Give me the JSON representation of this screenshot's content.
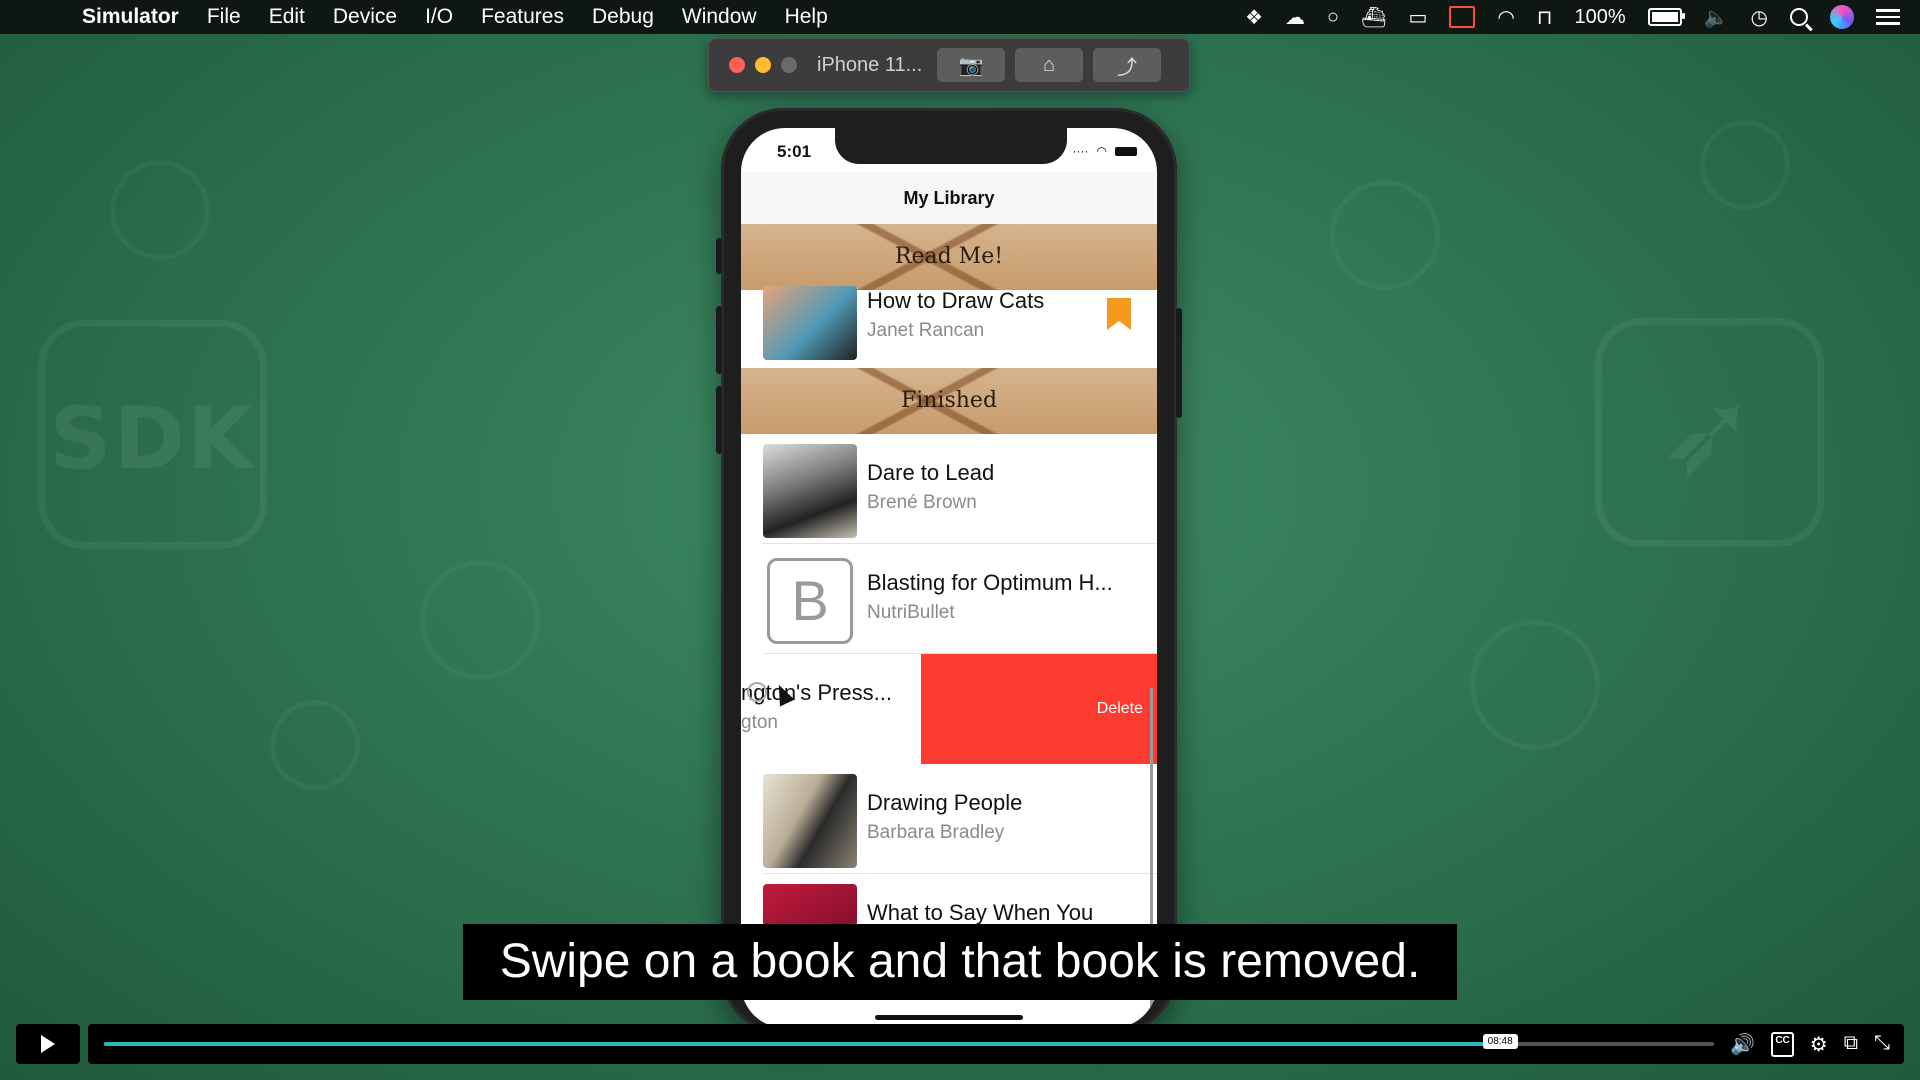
{
  "menubar": {
    "app_name": "Simulator",
    "items": [
      "File",
      "Edit",
      "Device",
      "I/O",
      "Features",
      "Debug",
      "Window",
      "Help"
    ],
    "battery_percent": "100%"
  },
  "simulator": {
    "device_name": "iPhone 11...",
    "buttons": [
      "camera-icon",
      "home-icon",
      "rotate-icon"
    ]
  },
  "phone": {
    "status_time": "5:01",
    "nav_title": "My Library",
    "sections": [
      {
        "title": "Read Me!"
      },
      {
        "title": "Finished"
      }
    ],
    "read_me_books": [
      {
        "title": "How to Draw Cats",
        "author": "Janet Rancan",
        "bookmarked": true
      }
    ],
    "finished_books": [
      {
        "title": "Dare to Lead",
        "author": "Brené Brown"
      },
      {
        "title": "Blasting for Optimum H...",
        "author": "NutriBullet",
        "placeholder": "B"
      },
      {
        "title": "ngton's Press...",
        "author": "gton",
        "swiped": true,
        "action": "Delete"
      },
      {
        "title": "Drawing People",
        "author": "Barbara Bradley"
      },
      {
        "title": "What to Say When You",
        "author": ""
      }
    ]
  },
  "caption": "Swipe on a book and that book is removed.",
  "video": {
    "progress": 0.865,
    "hover_time": "08:48",
    "accent_color": "#2bb7b7"
  }
}
